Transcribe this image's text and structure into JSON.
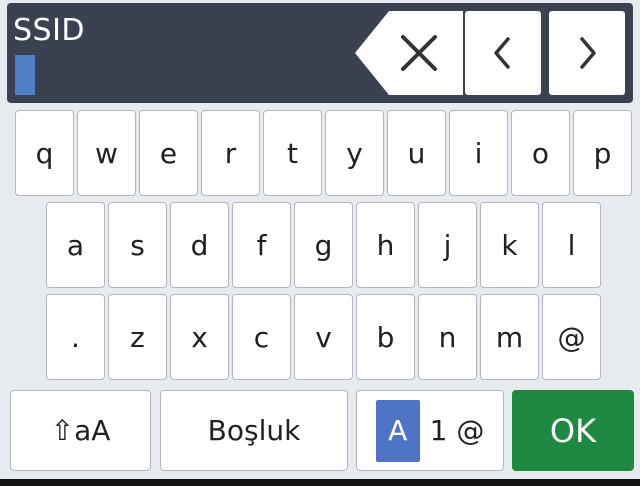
{
  "header": {
    "field_label": "SSID",
    "input_value": ""
  },
  "keyboard": {
    "row1": [
      "q",
      "w",
      "e",
      "r",
      "t",
      "y",
      "u",
      "i",
      "o",
      "p"
    ],
    "row2": [
      "a",
      "s",
      "d",
      "f",
      "g",
      "h",
      "j",
      "k",
      "l"
    ],
    "row3": [
      ".",
      "z",
      "x",
      "c",
      "v",
      "b",
      "n",
      "m",
      "@"
    ],
    "shift_label": "⇧aA",
    "space_label": "Boşluk",
    "mode": {
      "active": "A",
      "others": "1 @"
    },
    "ok_label": "OK"
  },
  "colors": {
    "header_bg": "#3b4150",
    "cursor": "#4f80c6",
    "mode_active": "#4f74c6",
    "ok_bg": "#1e8a41"
  }
}
